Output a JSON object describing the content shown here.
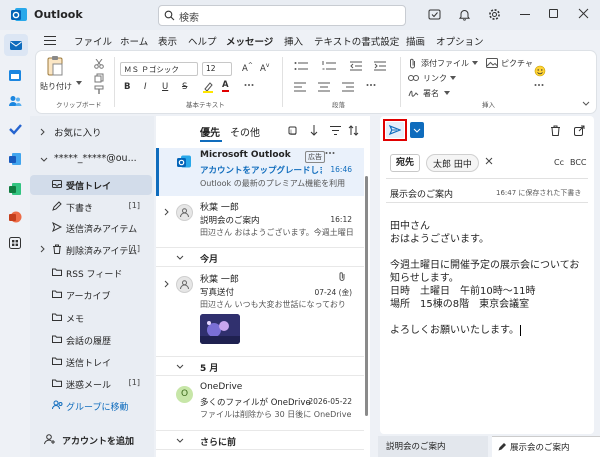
{
  "window": {
    "title": "Outlook"
  },
  "search": {
    "placeholder": "検索"
  },
  "ribbon_tabs": [
    "ファイル",
    "ホーム",
    "表示",
    "ヘルプ",
    "メッセージ",
    "挿入",
    "テキストの書式設定",
    "描画",
    "オプション"
  ],
  "ribbon": {
    "clipboard": {
      "paste_label": "貼り付け",
      "group_label": "クリップボード"
    },
    "text": {
      "font_name": "ＭＳ Ｐゴシック",
      "font_size": "12",
      "bold": "B",
      "italic": "I",
      "underline": "U",
      "strike": "S",
      "font_color": "A",
      "group_label": "基本テキスト"
    },
    "paragraph": {
      "group_label": "段落"
    },
    "insert": {
      "attach_label": "添付ファイル",
      "picture_label": "ピクチャ",
      "link_label": "リンク",
      "signature_label": "署名",
      "group_label": "挿入"
    }
  },
  "folders": {
    "favorites": "お気に入り",
    "account": "*****_*****@ou...",
    "items": [
      {
        "label": "受信トレイ",
        "count": ""
      },
      {
        "label": "下書き",
        "count": "[1]"
      },
      {
        "label": "送信済みアイテム",
        "count": ""
      },
      {
        "label": "削除済みアイテム",
        "count": "[1]"
      },
      {
        "label": "RSS フィード",
        "count": ""
      },
      {
        "label": "アーカイブ",
        "count": ""
      },
      {
        "label": "メモ",
        "count": ""
      },
      {
        "label": "会話の履歴",
        "count": ""
      },
      {
        "label": "送信トレイ",
        "count": ""
      },
      {
        "label": "迷惑メール",
        "count": "[1]"
      }
    ],
    "group_link": "グループに移動",
    "add_account": "アカウントを追加"
  },
  "message_list": {
    "tab_focused": "優先",
    "tab_other": "その他",
    "messages": [
      {
        "sender": "Microsoft Outlook",
        "badge": "広告",
        "subject": "アカウントをアップグレードしましょう",
        "time": "16:46",
        "preview": "Outlook の最新のプレミアム機能を利用"
      },
      {
        "sender": "秋葉 一郎",
        "subject": "説明会のご案内",
        "time": "16:12",
        "preview": "田辺さん おはようございます。今週土曜日"
      }
    ],
    "section_month": "今月",
    "month_message": {
      "sender": "秋葉 一郎",
      "subject": "写真送付",
      "time": "07-24 (金)",
      "preview": "田辺さん いつも大変お世話になっており"
    },
    "section_may": "5 月",
    "may_message": {
      "sender": "OneDrive",
      "avatar": "O",
      "subject": "多くのファイルが OneDrive...",
      "time": "2026-05-22",
      "preview": "ファイルは削除から 30 日後に OneDrive"
    },
    "section_earlier": "さらに前"
  },
  "compose": {
    "to_label": "宛先",
    "recipient": "太郎 田中",
    "cc": "Cc",
    "bcc": "BCC",
    "subject": "展示会のご案内",
    "saved": "16:47 に保存された下書き",
    "body": [
      "田中さん",
      "おはようございます。",
      "",
      "今週土曜日に開催予定の展示会についてお知らせします。",
      "日時　土曜日　午前10時～11時",
      "場所　15棟の8階　東京会議室",
      "",
      "よろしくお願いいたします。"
    ]
  },
  "bottom_tabs": [
    {
      "label": "説明会のご案内"
    },
    {
      "label": "展示会のご案内"
    }
  ],
  "colors": {
    "accent": "#0f6cbd",
    "highlight": "#e00000",
    "link": "#0f6cbd"
  }
}
